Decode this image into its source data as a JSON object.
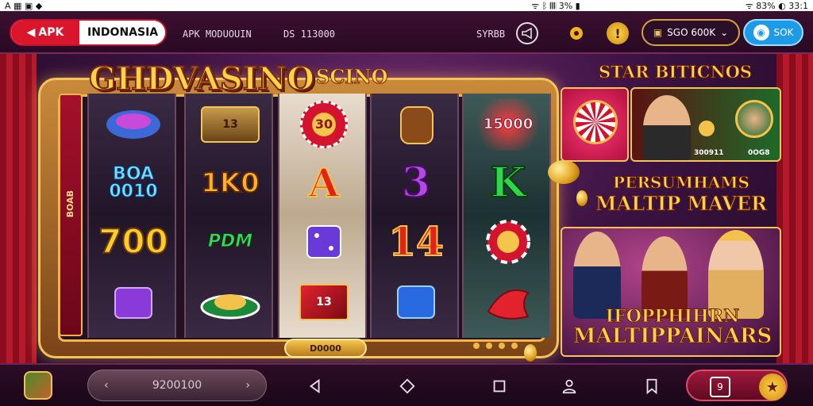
{
  "status_bar": {
    "left_text": "A ▦ ▣ ◆",
    "right_text": "ᯤ ᛒ 𝄃𝄃𝄃 3% ▮",
    "right_text_2": "ᯤ 83% ◐ 33:1"
  },
  "header": {
    "brand_apk": "APK",
    "brand_country": "INDONASIA",
    "text_1": "APK MODUOUIN",
    "text_2": "DS 113000",
    "text_3": "SYRBB",
    "coins": "SGO 600K",
    "account": "SOK"
  },
  "game": {
    "logo": "GHDVASINO",
    "logo_sub": "SCINO",
    "side_label": "BOAB",
    "bet_value": "D0000",
    "reels": [
      [
        "",
        "BOA 0010",
        "700",
        ""
      ],
      [
        "13",
        "1K0",
        "PDM",
        ""
      ],
      [
        "30",
        "A",
        "",
        "13"
      ],
      [
        "",
        "3",
        "14",
        ""
      ],
      [
        "15000",
        "K",
        "",
        ""
      ]
    ]
  },
  "right_panel": {
    "title": "STAR BITICNOS",
    "card2_caption_1": "300911",
    "card2_caption_2": "0OG8",
    "promo_line_1": "PERSUMHAMS",
    "promo_line_2": "MALTIP MAVER",
    "card3_line_1": "IFOPPHIHRN",
    "card3_line_2": "MALTIPPAINARS"
  },
  "bottom_nav": {
    "pager_value": "9200100",
    "square_btn": "9",
    "star_btn": "★"
  },
  "colors": {
    "accent_gold": "#ffd24a",
    "brand_red": "#d9162c",
    "account_blue": "#1e9be8"
  }
}
